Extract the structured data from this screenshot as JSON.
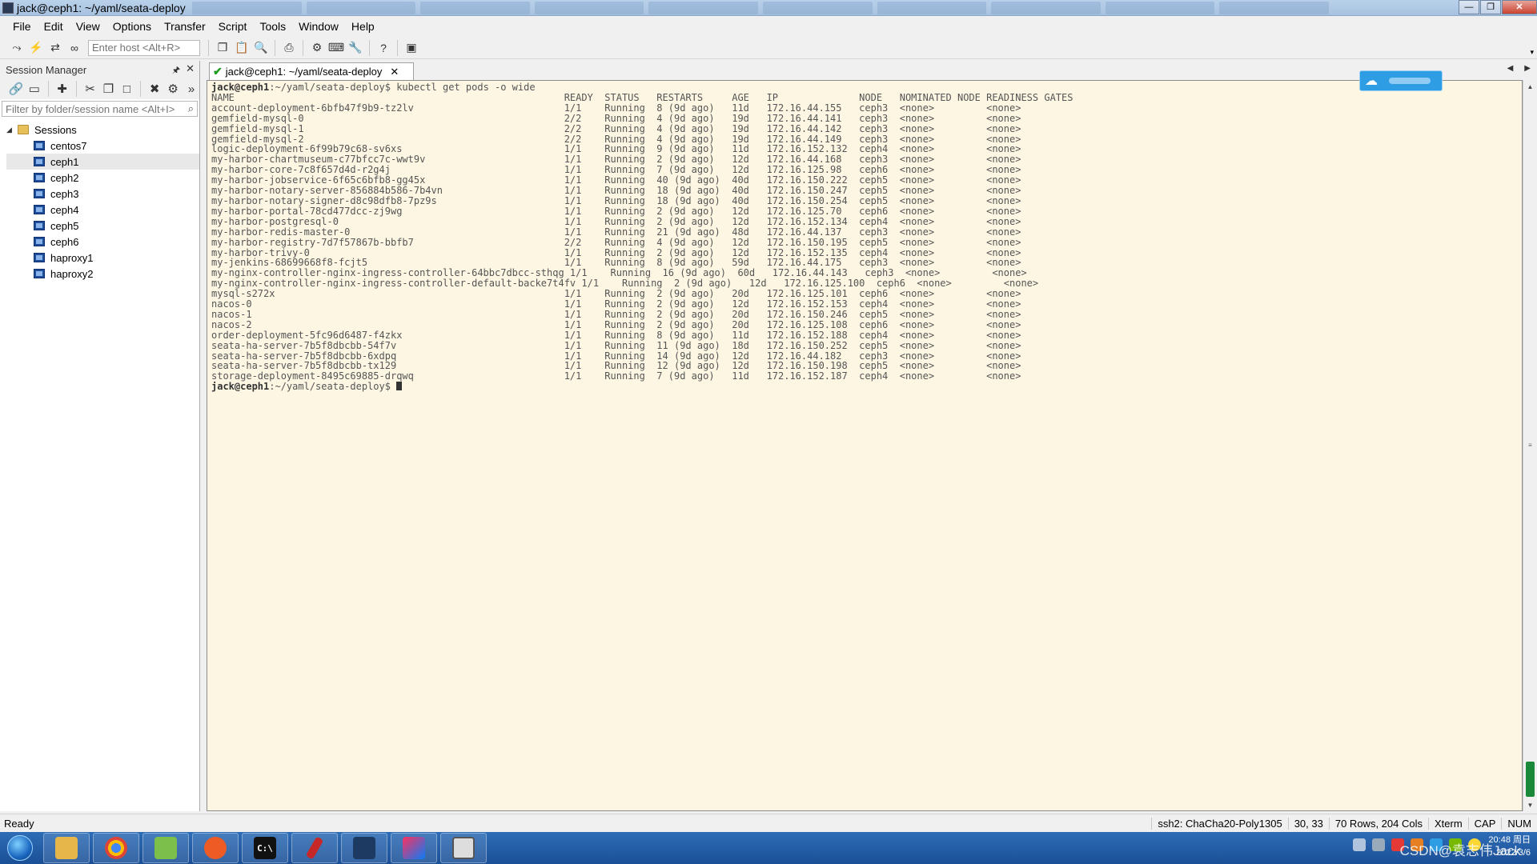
{
  "window": {
    "title": "jack@ceph1: ~/yaml/seata-deploy"
  },
  "menubar": {
    "items": [
      "File",
      "Edit",
      "View",
      "Options",
      "Transfer",
      "Script",
      "Tools",
      "Window",
      "Help"
    ]
  },
  "toolbar": {
    "host_placeholder": "Enter host <Alt+R>"
  },
  "session_manager": {
    "title": "Session Manager",
    "filter_placeholder": "Filter by folder/session name <Alt+I>",
    "root": "Sessions",
    "sessions": [
      "centos7",
      "ceph1",
      "ceph2",
      "ceph3",
      "ceph4",
      "ceph5",
      "ceph6",
      "haproxy1",
      "haproxy2"
    ],
    "selected": "ceph1"
  },
  "tab": {
    "label": "jack@ceph1: ~/yaml/seata-deploy"
  },
  "terminal": {
    "prompt": "jack@ceph1",
    "path": ":~/yaml/seata-deploy$",
    "command": " kubectl get pods -o wide",
    "columns": [
      "NAME",
      "READY",
      "STATUS",
      "RESTARTS",
      "AGE",
      "IP",
      "NODE",
      "NOMINATED NODE",
      "READINESS GATES"
    ],
    "rows": [
      [
        "account-deployment-6bfb47f9b9-tz2lv",
        "1/1",
        "Running",
        "8 (9d ago)",
        "11d",
        "172.16.44.155",
        "ceph3",
        "<none>",
        "<none>"
      ],
      [
        "gemfield-mysql-0",
        "2/2",
        "Running",
        "4 (9d ago)",
        "19d",
        "172.16.44.141",
        "ceph3",
        "<none>",
        "<none>"
      ],
      [
        "gemfield-mysql-1",
        "2/2",
        "Running",
        "4 (9d ago)",
        "19d",
        "172.16.44.142",
        "ceph3",
        "<none>",
        "<none>"
      ],
      [
        "gemfield-mysql-2",
        "2/2",
        "Running",
        "4 (9d ago)",
        "19d",
        "172.16.44.149",
        "ceph3",
        "<none>",
        "<none>"
      ],
      [
        "logic-deployment-6f99b79c68-sv6xs",
        "1/1",
        "Running",
        "9 (9d ago)",
        "11d",
        "172.16.152.132",
        "ceph4",
        "<none>",
        "<none>"
      ],
      [
        "my-harbor-chartmuseum-c77bfcc7c-wwt9v",
        "1/1",
        "Running",
        "2 (9d ago)",
        "12d",
        "172.16.44.168",
        "ceph3",
        "<none>",
        "<none>"
      ],
      [
        "my-harbor-core-7c8f657d4d-r2g4j",
        "1/1",
        "Running",
        "7 (9d ago)",
        "12d",
        "172.16.125.98",
        "ceph6",
        "<none>",
        "<none>"
      ],
      [
        "my-harbor-jobservice-6f65c6bfb8-gg45x",
        "1/1",
        "Running",
        "40 (9d ago)",
        "40d",
        "172.16.150.222",
        "ceph5",
        "<none>",
        "<none>"
      ],
      [
        "my-harbor-notary-server-856884b586-7b4vn",
        "1/1",
        "Running",
        "18 (9d ago)",
        "40d",
        "172.16.150.247",
        "ceph5",
        "<none>",
        "<none>"
      ],
      [
        "my-harbor-notary-signer-d8c98dfb8-7pz9s",
        "1/1",
        "Running",
        "18 (9d ago)",
        "40d",
        "172.16.150.254",
        "ceph5",
        "<none>",
        "<none>"
      ],
      [
        "my-harbor-portal-78cd477dcc-zj9wg",
        "1/1",
        "Running",
        "2 (9d ago)",
        "12d",
        "172.16.125.70",
        "ceph6",
        "<none>",
        "<none>"
      ],
      [
        "my-harbor-postgresql-0",
        "1/1",
        "Running",
        "2 (9d ago)",
        "12d",
        "172.16.152.134",
        "ceph4",
        "<none>",
        "<none>"
      ],
      [
        "my-harbor-redis-master-0",
        "1/1",
        "Running",
        "21 (9d ago)",
        "48d",
        "172.16.44.137",
        "ceph3",
        "<none>",
        "<none>"
      ],
      [
        "my-harbor-registry-7d7f57867b-bbfb7",
        "2/2",
        "Running",
        "4 (9d ago)",
        "12d",
        "172.16.150.195",
        "ceph5",
        "<none>",
        "<none>"
      ],
      [
        "my-harbor-trivy-0",
        "1/1",
        "Running",
        "2 (9d ago)",
        "12d",
        "172.16.152.135",
        "ceph4",
        "<none>",
        "<none>"
      ],
      [
        "my-jenkins-68699668f8-fcjt5",
        "1/1",
        "Running",
        "8 (9d ago)",
        "59d",
        "172.16.44.175",
        "ceph3",
        "<none>",
        "<none>"
      ],
      [
        "my-nginx-controller-nginx-ingress-controller-64bbc7dbcc-sthqg",
        "1/1",
        "Running",
        "16 (9d ago)",
        "60d",
        "172.16.44.143",
        "ceph3",
        "<none>",
        "<none>"
      ],
      [
        "my-nginx-controller-nginx-ingress-controller-default-backe7t4fv",
        "1/1",
        "Running",
        "2 (9d ago)",
        "12d",
        "172.16.125.100",
        "ceph6",
        "<none>",
        "<none>"
      ],
      [
        "mysql-s272x",
        "1/1",
        "Running",
        "2 (9d ago)",
        "20d",
        "172.16.125.101",
        "ceph6",
        "<none>",
        "<none>"
      ],
      [
        "nacos-0",
        "1/1",
        "Running",
        "2 (9d ago)",
        "12d",
        "172.16.152.153",
        "ceph4",
        "<none>",
        "<none>"
      ],
      [
        "nacos-1",
        "1/1",
        "Running",
        "2 (9d ago)",
        "20d",
        "172.16.150.246",
        "ceph5",
        "<none>",
        "<none>"
      ],
      [
        "nacos-2",
        "1/1",
        "Running",
        "2 (9d ago)",
        "20d",
        "172.16.125.108",
        "ceph6",
        "<none>",
        "<none>"
      ],
      [
        "order-deployment-5fc96d6487-f4zkx",
        "1/1",
        "Running",
        "8 (9d ago)",
        "11d",
        "172.16.152.188",
        "ceph4",
        "<none>",
        "<none>"
      ],
      [
        "seata-ha-server-7b5f8dbcbb-54f7v",
        "1/1",
        "Running",
        "11 (9d ago)",
        "18d",
        "172.16.150.252",
        "ceph5",
        "<none>",
        "<none>"
      ],
      [
        "seata-ha-server-7b5f8dbcbb-6xdpq",
        "1/1",
        "Running",
        "14 (9d ago)",
        "12d",
        "172.16.44.182",
        "ceph3",
        "<none>",
        "<none>"
      ],
      [
        "seata-ha-server-7b5f8dbcbb-tx129",
        "1/1",
        "Running",
        "12 (9d ago)",
        "12d",
        "172.16.150.198",
        "ceph5",
        "<none>",
        "<none>"
      ],
      [
        "storage-deployment-8495c69885-drqwq",
        "1/1",
        "Running",
        "7 (9d ago)",
        "11d",
        "172.16.152.187",
        "ceph4",
        "<none>",
        "<none>"
      ]
    ]
  },
  "statusbar": {
    "ready": "Ready",
    "cipher": "ssh2: ChaCha20-Poly1305",
    "cursor_pos": "30,  33",
    "size": "70 Rows, 204 Cols",
    "term": "Xterm",
    "cap": "CAP",
    "num": "NUM"
  },
  "taskbar": {
    "watermark": "CSDN@袁志伟Jack",
    "time": "20:48 周日",
    "date": "2022/3/6"
  },
  "colors": {
    "terminal_bg": "#fdf6e3",
    "terminal_fg": "#555555",
    "taskbar": "#1b4f96"
  }
}
